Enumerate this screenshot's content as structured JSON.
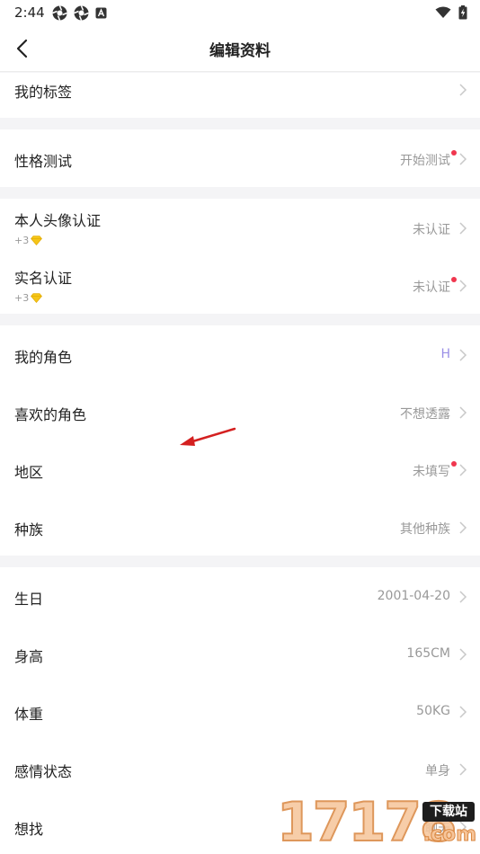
{
  "status_bar": {
    "time": "2:44",
    "left_icons": [
      "aperture-icon",
      "aperture-icon",
      "a-badge-icon"
    ],
    "right_icons": [
      "wifi-icon",
      "battery-charging-icon"
    ]
  },
  "header": {
    "title": "编辑资料",
    "back_icon": "back-arrow-icon"
  },
  "sections": {
    "tags": {
      "label": "我的标签",
      "value": ""
    },
    "personality": {
      "label": "性格测试",
      "value": "开始测试",
      "has_dot": true
    },
    "verification": {
      "avatar": {
        "label": "本人头像认证",
        "reward": "+3",
        "value": "未认证",
        "has_dot": false
      },
      "realname": {
        "label": "实名认证",
        "reward": "+3",
        "value": "未认证",
        "has_dot": true
      }
    },
    "profile": {
      "my_role": {
        "label": "我的角色",
        "value": "H"
      },
      "fav_role": {
        "label": "喜欢的角色",
        "value": "不想透露"
      },
      "region": {
        "label": "地区",
        "value": "未填写",
        "has_dot": true
      },
      "race": {
        "label": "种族",
        "value": "其他种族"
      }
    },
    "basics": {
      "birthday": {
        "label": "生日",
        "value": "2001-04-20"
      },
      "height": {
        "label": "身高",
        "value": "165CM"
      },
      "weight": {
        "label": "体重",
        "value": "50KG"
      },
      "relationship": {
        "label": "感情状态",
        "value": "单身"
      },
      "seeking": {
        "label": "想找",
        "value": "聊天"
      }
    }
  },
  "colors": {
    "accent_dot": "#f0364e",
    "value_gray": "#999999",
    "role_value": "#9a8fe6",
    "diamond": "#f5c518"
  },
  "watermark": {
    "digits": "17178",
    "badge": "下载站",
    "domain": ".com"
  }
}
